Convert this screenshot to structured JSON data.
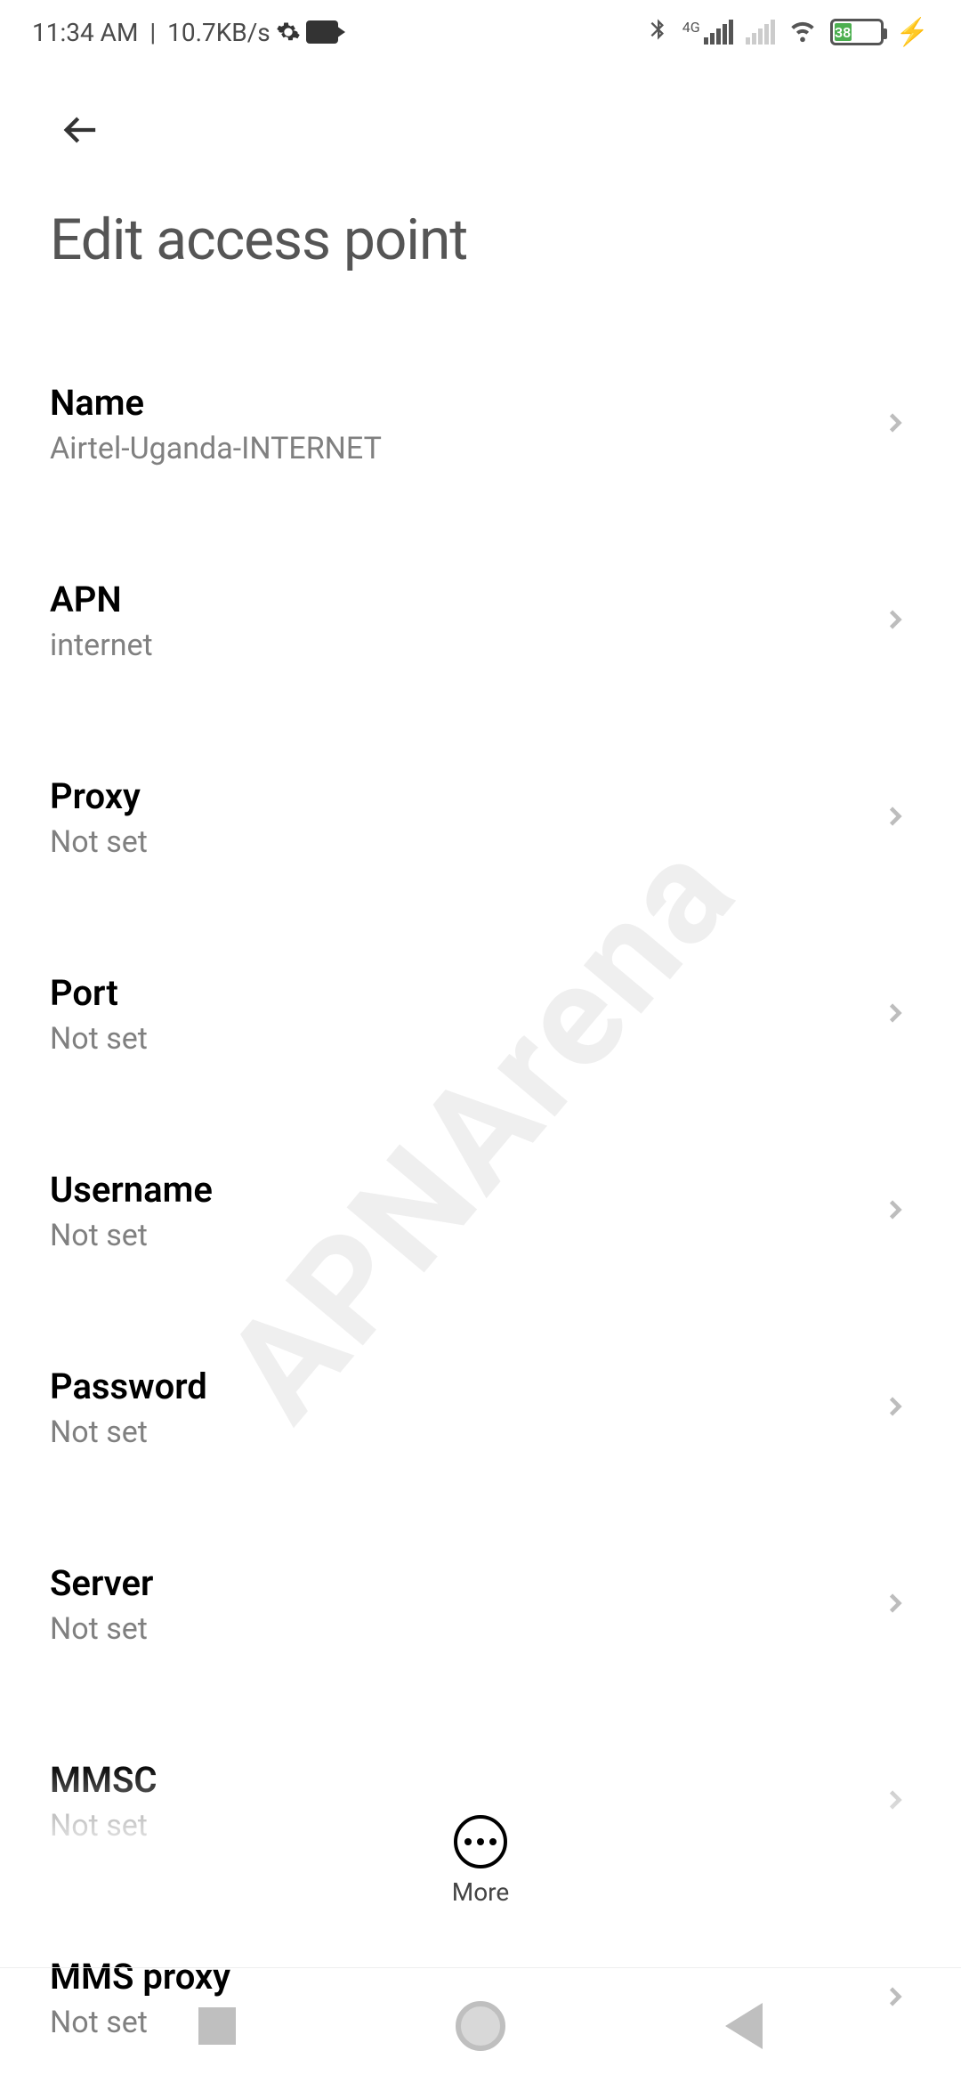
{
  "status": {
    "time": "11:34 AM",
    "speed": "10.7KB/s",
    "network_label": "4G",
    "battery_percent": "38"
  },
  "header": {
    "title": "Edit access point"
  },
  "rows": [
    {
      "label": "Name",
      "value": "Airtel-Uganda-INTERNET"
    },
    {
      "label": "APN",
      "value": "internet"
    },
    {
      "label": "Proxy",
      "value": "Not set"
    },
    {
      "label": "Port",
      "value": "Not set"
    },
    {
      "label": "Username",
      "value": "Not set"
    },
    {
      "label": "Password",
      "value": "Not set"
    },
    {
      "label": "Server",
      "value": "Not set"
    },
    {
      "label": "MMSC",
      "value": "Not set"
    },
    {
      "label": "MMS proxy",
      "value": "Not set"
    }
  ],
  "bottom": {
    "more": "More"
  },
  "watermark": "APNArena"
}
